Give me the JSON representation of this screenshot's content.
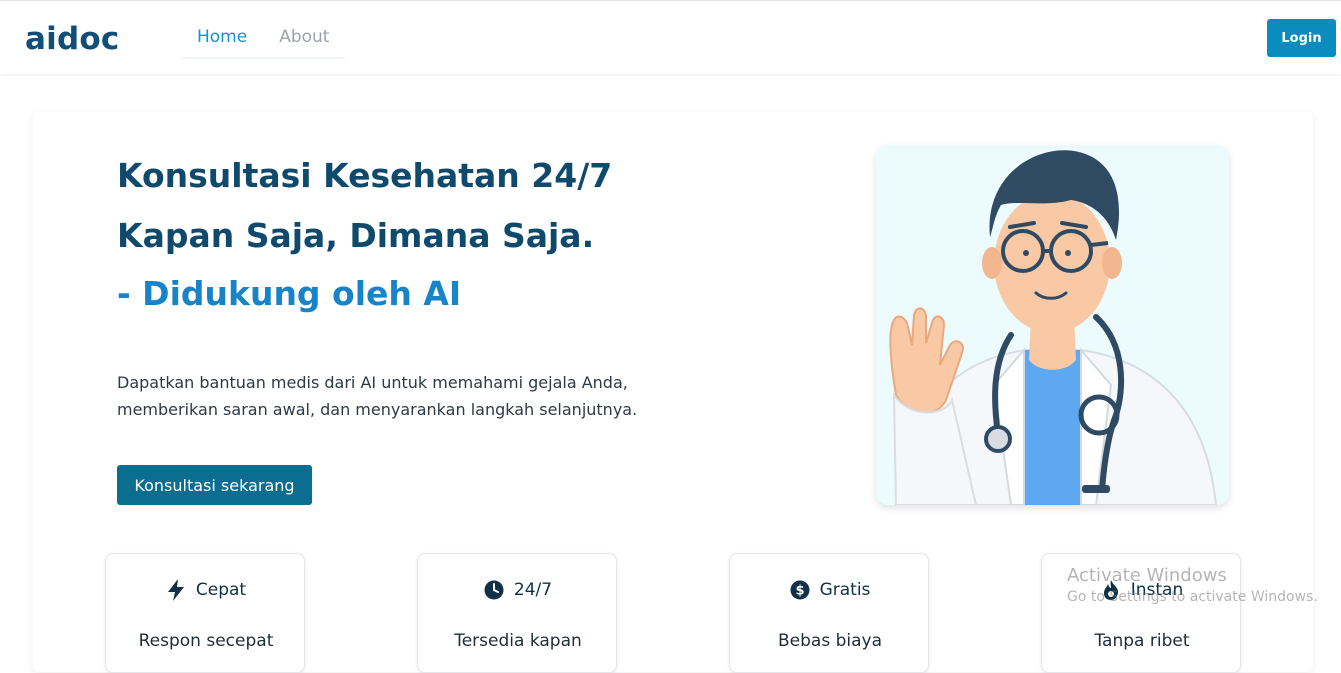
{
  "header": {
    "brand": "aidoc",
    "nav": [
      "Home",
      "About"
    ],
    "login": "Login"
  },
  "hero": {
    "line1": "Konsultasi Kesehatan 24/7",
    "line2": "Kapan Saja, Dimana Saja.",
    "line3": "- Didukung oleh AI",
    "desc_line1": "Dapatkan bantuan medis dari AI untuk memahami gejala Anda,",
    "desc_line2": "memberikan saran awal, dan menyarankan langkah selanjutnya.",
    "cta": "Konsultasi sekarang"
  },
  "features": [
    {
      "title": "Cepat",
      "icon": "lightning-icon",
      "desc": "Respon secepat"
    },
    {
      "title": "24/7",
      "icon": "clock-icon",
      "desc": "Tersedia kapan"
    },
    {
      "title": "Gratis",
      "icon": "dollar-icon",
      "desc": "Bebas biaya"
    },
    {
      "title": "Instan",
      "icon": "fire-icon",
      "desc": "Tanpa ribet"
    }
  ],
  "watermark": {
    "line1": "Activate Windows",
    "line2": "Go to Settings to activate Windows."
  }
}
